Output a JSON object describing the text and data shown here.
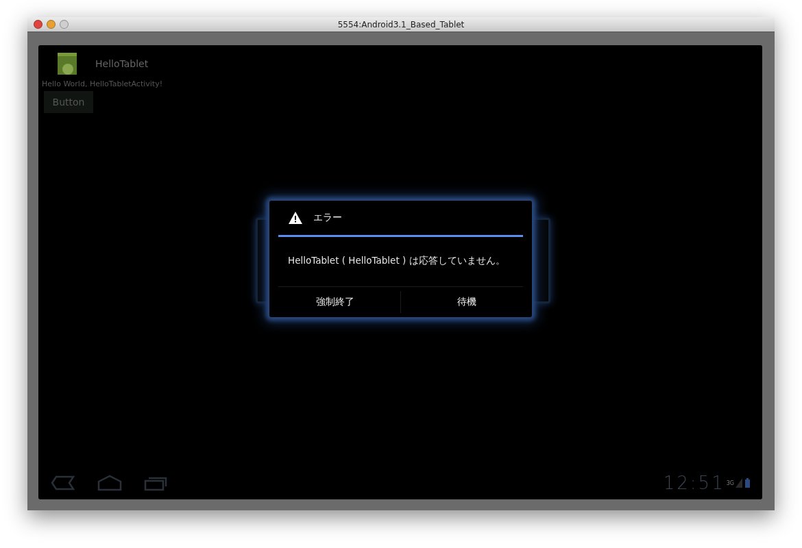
{
  "window": {
    "title": "5554:Android3.1_Based_Tablet"
  },
  "app": {
    "title": "HelloTablet",
    "text": "Hello World, HelloTabletActivity!",
    "button": "Button"
  },
  "dialog": {
    "title": "エラー",
    "message": "HelloTablet ( HelloTablet ) は応答していません。",
    "buttons": [
      "強制終了",
      "待機"
    ]
  },
  "status_bar": {
    "time": "12:51",
    "network": "3G"
  }
}
